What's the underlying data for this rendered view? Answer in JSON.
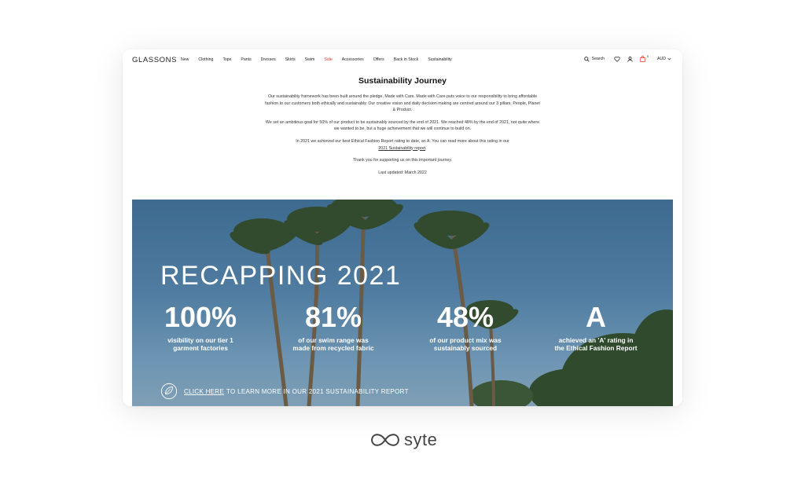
{
  "header": {
    "logo": "GLASSONS",
    "menu": [
      "New",
      "Clothing",
      "Tops",
      "Pants",
      "Dresses",
      "Skirts",
      "Swim",
      "Sale",
      "Accessories",
      "Offers",
      "Back in Stock",
      "Sustainability"
    ],
    "search_label": "Search",
    "bag_count": "0",
    "currency": "AUD"
  },
  "intro": {
    "title": "Sustainability Journey",
    "p1": "Our sustainability framework has been built around the pledge, Made with Care. Made with Care puts voice to our responsibility to bring affordable fashion to our customers both ethically and sustainably. Our creative vision and daily decision making are centred around our 3 pillars; People, Planet & Product.",
    "p2": "We set an ambitious goal for 50% of our product to be sustainably sourced by the end of 2021. We reached 48% by the end of 2021, not quite where we wanted to be, but a huge achievement that we will continue to build on.",
    "p3_pre": "In 2021 we achieved our best Ethical Fashion Report rating to date, an A. You can read more about this rating in our",
    "p3_link": "2021 Sustainability report",
    "p3_post": ".",
    "p4": "Thank you for supporting us on this important journey.",
    "p5": "Last updated: March 2022"
  },
  "hero": {
    "title": "RECAPPING 2021",
    "stats": [
      {
        "num": "100%",
        "cap1": "visibility on our tier 1",
        "cap2": "garment factories"
      },
      {
        "num": "81%",
        "cap1": "of our swim range was",
        "cap2": "made from recycled fabric"
      },
      {
        "num": "48%",
        "cap1": "of our product mix was",
        "cap2": "sustainably sourced"
      },
      {
        "num": "A",
        "cap1": "achieved an 'A' rating in",
        "cap2": "the Ethical Fashion Report"
      }
    ],
    "cta_link": "CLICK HERE",
    "cta_text": "TO LEARN MORE IN OUR 2021 SUSTAINABILITY REPORT"
  },
  "footer": {
    "brand": "syte"
  },
  "colors": {
    "sale": "#e03a2f",
    "sky": "#4f7ca0",
    "text": "#333333"
  }
}
